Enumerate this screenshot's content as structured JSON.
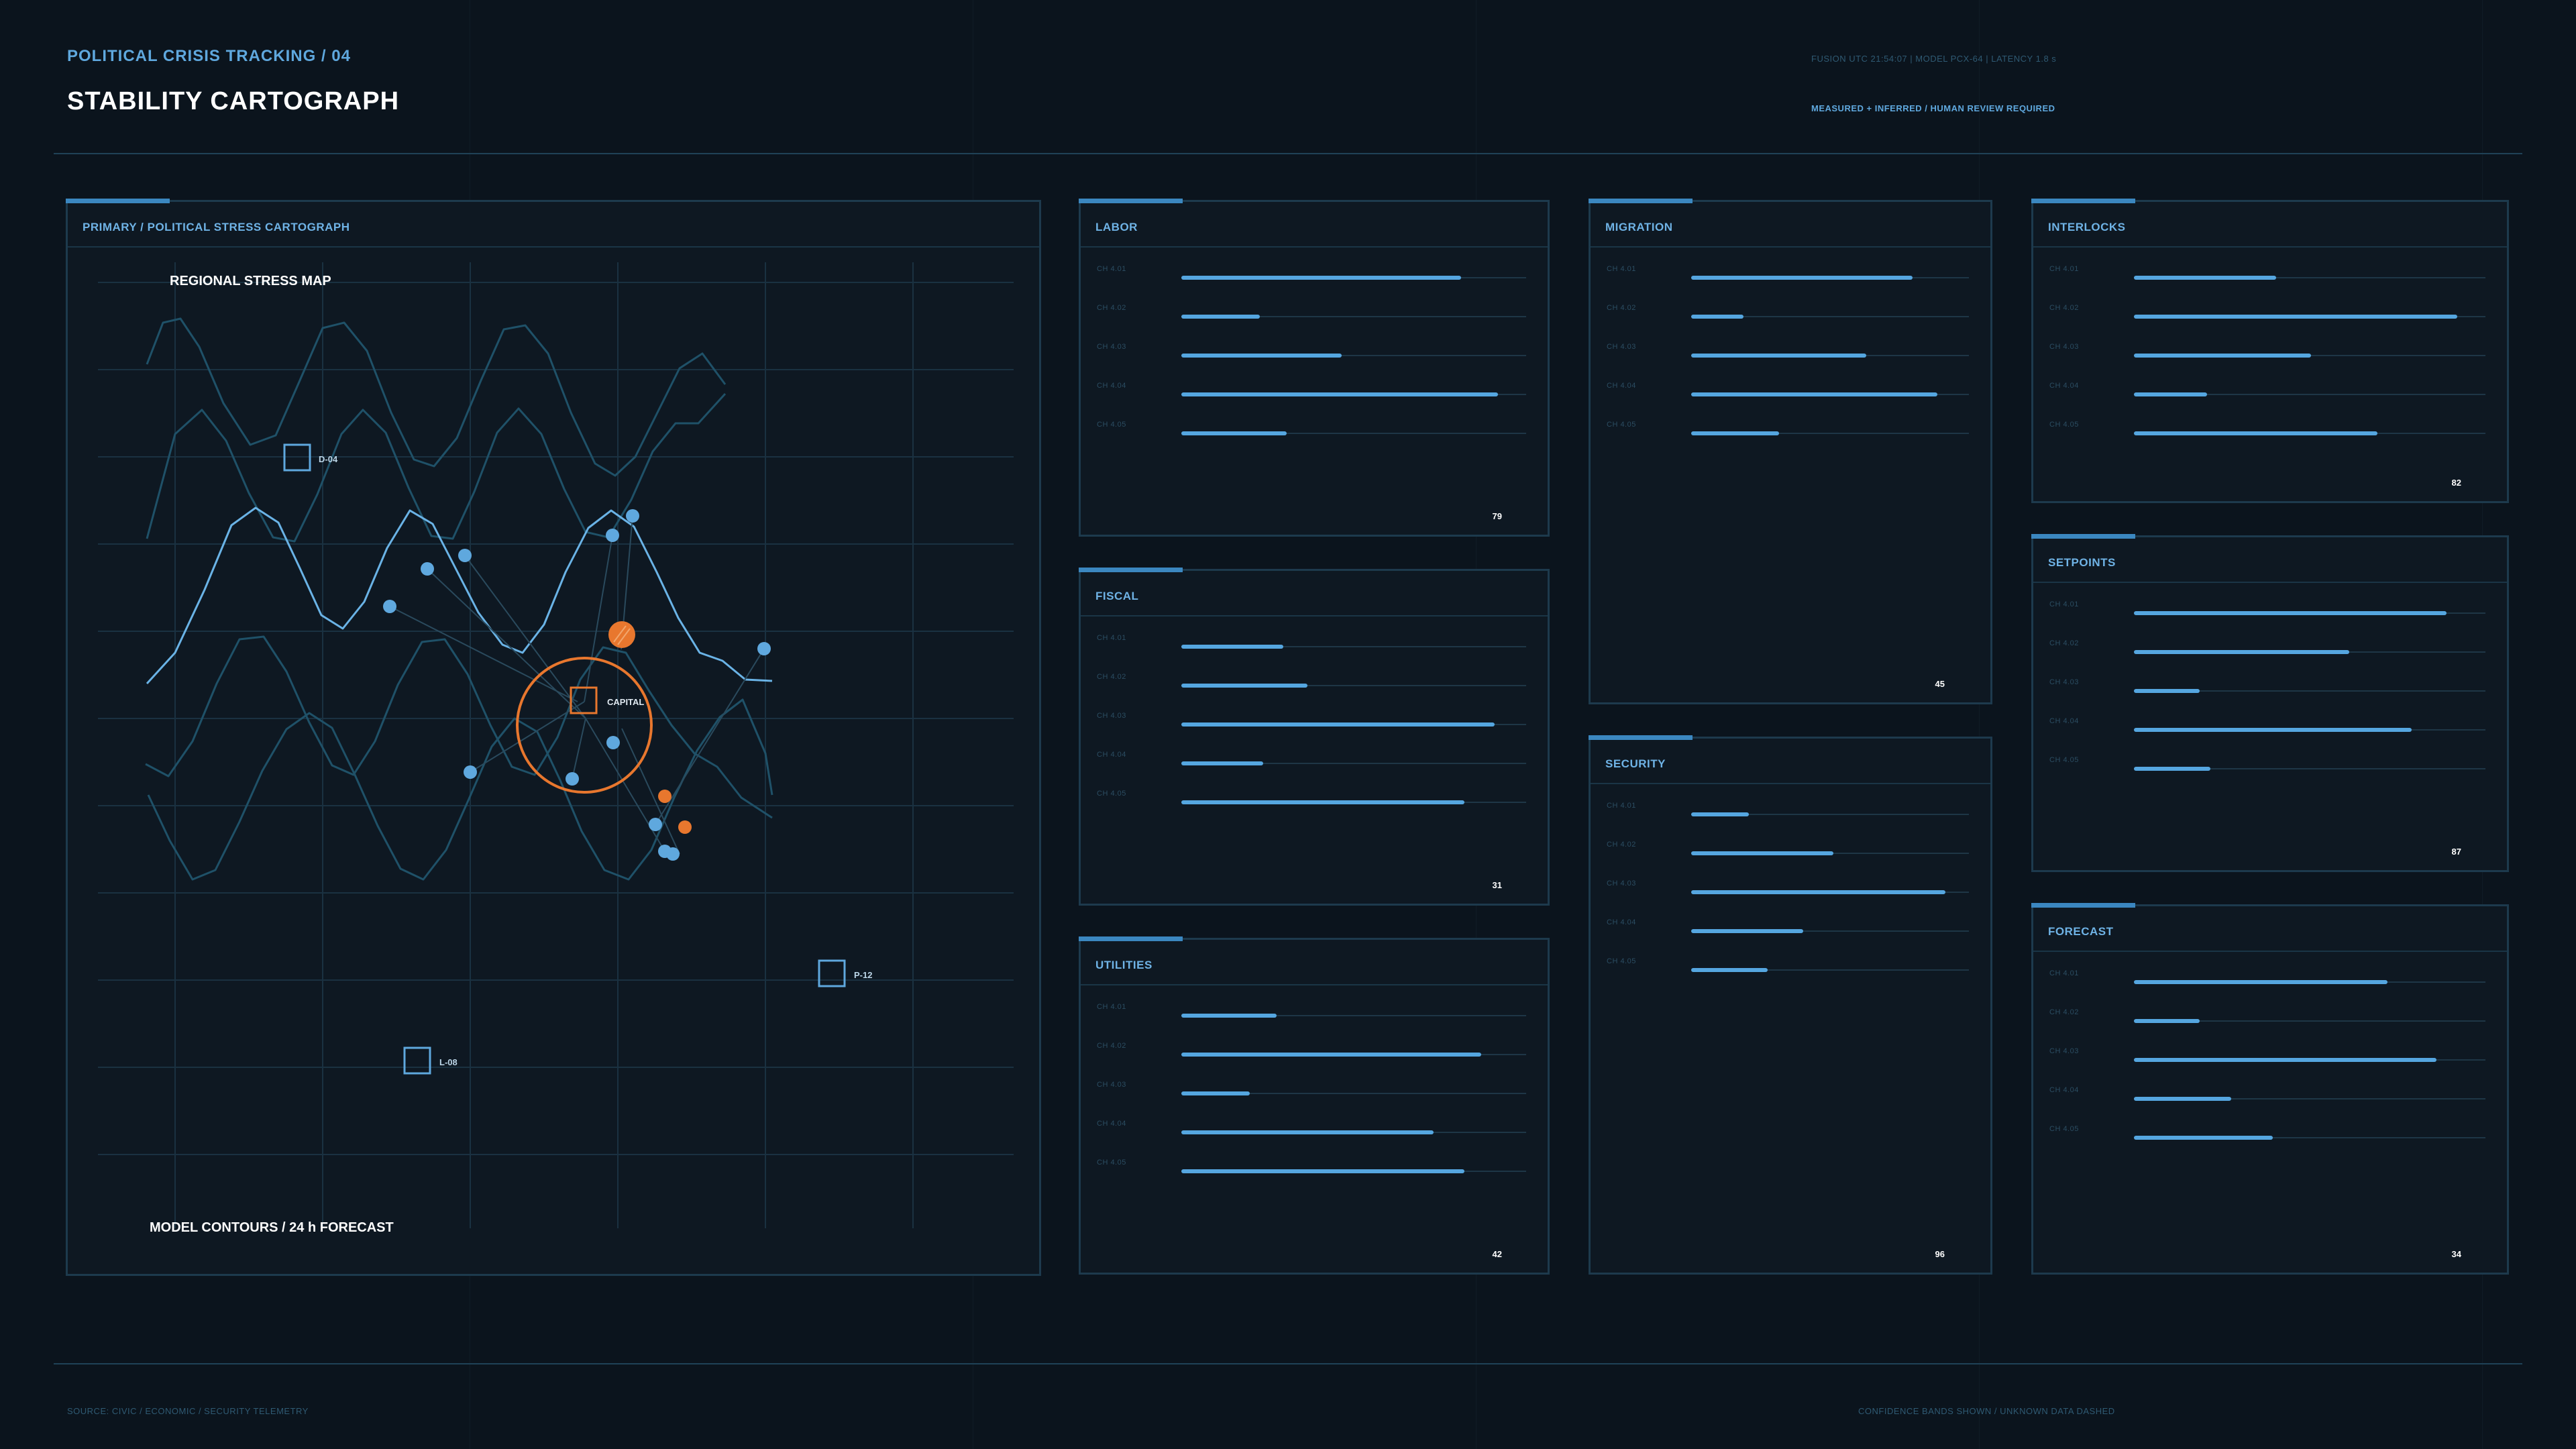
{
  "header": {
    "eyebrow": "POLITICAL CRISIS TRACKING / 04",
    "title": "STABILITY CARTOGRAPH",
    "meta": "FUSION UTC 21:54:07 | MODEL PCX-64 | LATENCY 1.8 s",
    "note": "MEASURED + INFERRED / HUMAN REVIEW REQUIRED"
  },
  "map": {
    "panel_label": "PRIMARY / POLITICAL STRESS CARTOGRAPH",
    "title": "REGIONAL STRESS MAP",
    "caption": "MODEL CONTOURS / 24 h FORECAST",
    "capital_label": "CAPITAL",
    "markers": [
      "D-04",
      "P-12",
      "L-08"
    ]
  },
  "panels": [
    {
      "id": "labor",
      "title": "LABOR",
      "value": "79",
      "levels": [
        0.82,
        0.23,
        0.47,
        0.93,
        0.31
      ]
    },
    {
      "id": "fiscal",
      "title": "FISCAL",
      "value": "31",
      "levels": [
        0.3,
        0.37,
        0.92,
        0.24,
        0.83
      ]
    },
    {
      "id": "utilities",
      "title": "UTILITIES",
      "value": "42",
      "levels": [
        0.28,
        0.88,
        0.2,
        0.74,
        0.83
      ]
    },
    {
      "id": "migration",
      "title": "MIGRATION",
      "value": "45",
      "levels": [
        0.81,
        0.19,
        0.64,
        0.9,
        0.32
      ]
    },
    {
      "id": "security",
      "title": "SECURITY",
      "value": "96",
      "levels": [
        0.21,
        0.52,
        0.93,
        0.41,
        0.28
      ]
    },
    {
      "id": "interlocks",
      "title": "INTERLOCKS",
      "value": "82",
      "levels": [
        0.41,
        0.93,
        0.51,
        0.21,
        0.7
      ]
    },
    {
      "id": "setpoints",
      "title": "SETPOINTS",
      "value": "87",
      "levels": [
        0.9,
        0.62,
        0.19,
        0.8,
        0.22
      ]
    },
    {
      "id": "forecast",
      "title": "FORECAST",
      "value": "34",
      "levels": [
        0.73,
        0.19,
        0.87,
        0.28,
        0.4
      ]
    }
  ],
  "channel_labels": [
    "CH 4.01",
    "CH 4.02",
    "CH 4.03",
    "CH 4.04",
    "CH 4.05"
  ],
  "footer": {
    "left": "SOURCE: CIVIC / ECONOMIC / SECURITY TELEMETRY",
    "right": "CONFIDENCE BANDS SHOWN / UNKNOWN DATA DASHED"
  },
  "colors": {
    "accent": "#5fa8de",
    "alert": "#e8772e",
    "panel_border": "#1d3a4d"
  }
}
